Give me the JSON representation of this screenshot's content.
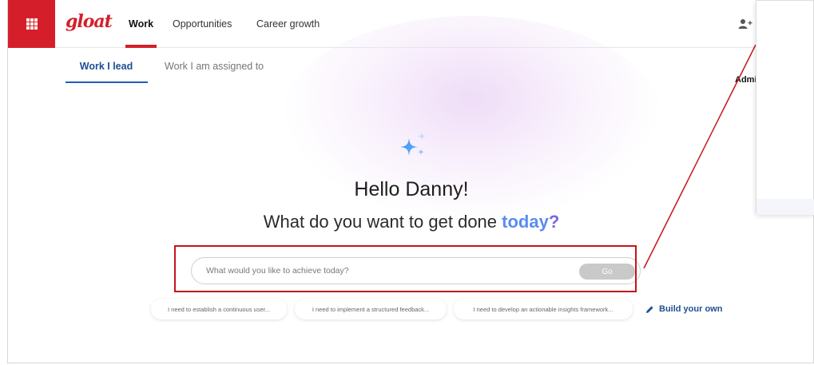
{
  "header": {
    "logo_text": "gloat",
    "nav": [
      {
        "label": "Work",
        "active": true
      },
      {
        "label": "Opportunities",
        "active": false
      },
      {
        "label": "Career growth",
        "active": false
      }
    ]
  },
  "tabs": [
    {
      "label": "Work I lead",
      "active": true
    },
    {
      "label": "Work I am assigned to",
      "active": false
    }
  ],
  "admin_label": "Admin",
  "hero": {
    "greeting": "Hello Danny!",
    "question_prefix": "What do you want to get done ",
    "question_highlight": "today",
    "question_mark": "?"
  },
  "search": {
    "placeholder": "What would you like to achieve today?",
    "go_label": "Go"
  },
  "suggestions": [
    "I need to establish a continuous user...",
    "I need to implement a structured feedback...",
    "I need to develop an actionable insights framework..."
  ],
  "build_your_own": "Build your own",
  "colors": {
    "brand_red": "#d41f2a",
    "link_blue": "#1f4f93",
    "today_blue": "#5b8cf0",
    "callout_red": "#c4151b"
  },
  "icons": {
    "apps": "apps-grid-icon",
    "add_user": "add-user-icon",
    "sparkle": "sparkle-icon",
    "edit": "pencil-icon"
  }
}
